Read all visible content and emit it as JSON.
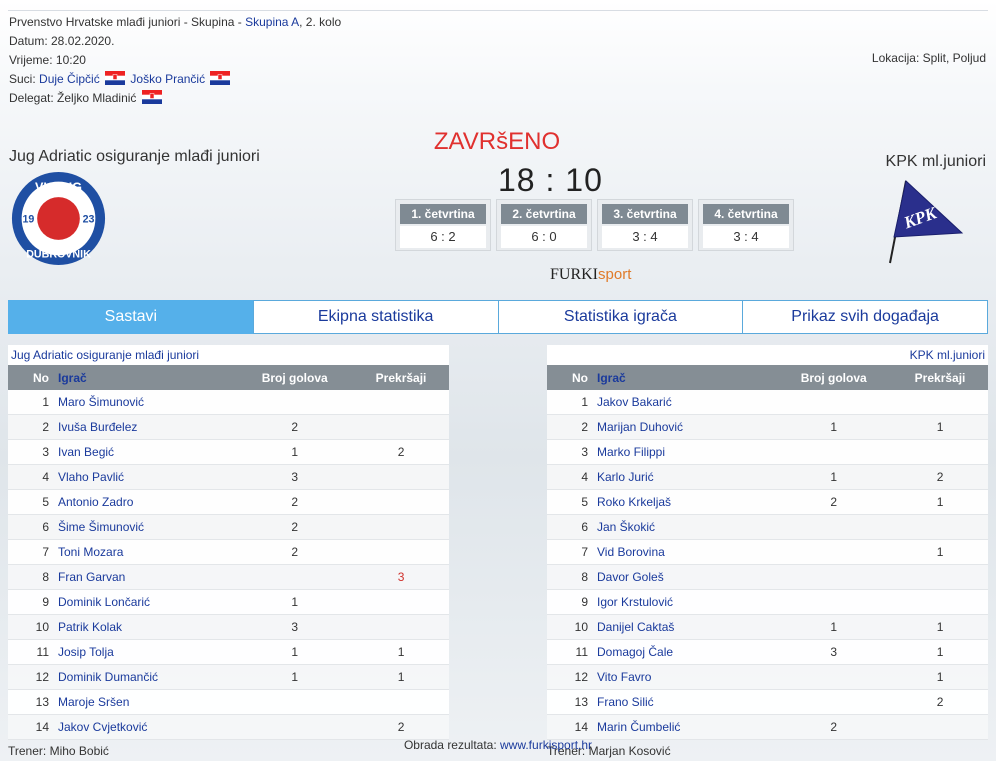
{
  "meta": {
    "competition_prefix": "Prvenstvo Hrvatske mlađi juniori - Skupina - ",
    "group_link": "Skupina A",
    "round": ", 2. kolo",
    "date": "Datum: 28.02.2020.",
    "time": "Vrijeme: 10:20",
    "referees_label": "Suci:",
    "referee_1": "Duje Čipčić",
    "referee_2": "Joško Prančić",
    "delegate_label": "Delegat:",
    "delegate": "Željko Mladinić",
    "location": "Lokacija: Split, Poljud"
  },
  "match": {
    "home_team": "Jug Adriatic osiguranje mlađi juniori",
    "away_team": "KPK ml.juniori",
    "status": "ZAVRšENO",
    "score": "18 : 10",
    "home_logo_text": {
      "top": "VK JUG",
      "bottom": "DUBROVNIK",
      "left": "19",
      "right": "23"
    },
    "away_logo_text": "KPK",
    "quarters": [
      {
        "label": "1. četvrtina",
        "score": "6 : 2"
      },
      {
        "label": "2. četvrtina",
        "score": "6 : 0"
      },
      {
        "label": "3. četvrtina",
        "score": "3 : 4"
      },
      {
        "label": "4. četvrtina",
        "score": "3 : 4"
      }
    ],
    "sponsor": {
      "a": "FURKI",
      "b": "sport"
    }
  },
  "tabs": [
    "Sastavi",
    "Ekipna statistika",
    "Statistika igrača",
    "Prikaz svih događaja"
  ],
  "columns": {
    "no": "No",
    "player": "Igrač",
    "goals": "Broj golova",
    "fouls": "Prekršaji"
  },
  "home": {
    "title": "Jug Adriatic osiguranje mlađi juniori",
    "coach": "Trener: Miho Bobić",
    "players": [
      {
        "no": "1",
        "name": "Maro Šimunović",
        "goals": "",
        "fouls": ""
      },
      {
        "no": "2",
        "name": "Ivuša Burđelez",
        "goals": "2",
        "fouls": ""
      },
      {
        "no": "3",
        "name": "Ivan Begić",
        "goals": "1",
        "fouls": "2"
      },
      {
        "no": "4",
        "name": "Vlaho Pavlić",
        "goals": "3",
        "fouls": ""
      },
      {
        "no": "5",
        "name": "Antonio Zadro",
        "goals": "2",
        "fouls": ""
      },
      {
        "no": "6",
        "name": "Šime Šimunović",
        "goals": "2",
        "fouls": ""
      },
      {
        "no": "7",
        "name": "Toni Mozara",
        "goals": "2",
        "fouls": ""
      },
      {
        "no": "8",
        "name": "Fran Garvan",
        "goals": "",
        "fouls": "3"
      },
      {
        "no": "9",
        "name": "Dominik Lončarić",
        "goals": "1",
        "fouls": ""
      },
      {
        "no": "10",
        "name": "Patrik Kolak",
        "goals": "3",
        "fouls": ""
      },
      {
        "no": "11",
        "name": "Josip Tolja",
        "goals": "1",
        "fouls": "1"
      },
      {
        "no": "12",
        "name": "Dominik Dumančić",
        "goals": "1",
        "fouls": "1"
      },
      {
        "no": "13",
        "name": "Maroje Sršen",
        "goals": "",
        "fouls": ""
      },
      {
        "no": "14",
        "name": "Jakov Cvjetković",
        "goals": "",
        "fouls": "2"
      }
    ]
  },
  "away": {
    "title": "KPK ml.juniori",
    "coach": "Trener: Marjan Kosović",
    "players": [
      {
        "no": "1",
        "name": "Jakov Bakarić",
        "goals": "",
        "fouls": ""
      },
      {
        "no": "2",
        "name": "Marijan Duhović",
        "goals": "1",
        "fouls": "1"
      },
      {
        "no": "3",
        "name": "Marko Filippi",
        "goals": "",
        "fouls": ""
      },
      {
        "no": "4",
        "name": "Karlo Jurić",
        "goals": "1",
        "fouls": "2"
      },
      {
        "no": "5",
        "name": "Roko Krkeljaš",
        "goals": "2",
        "fouls": "1"
      },
      {
        "no": "6",
        "name": "Jan Škokić",
        "goals": "",
        "fouls": ""
      },
      {
        "no": "7",
        "name": "Vid Borovina",
        "goals": "",
        "fouls": "1"
      },
      {
        "no": "8",
        "name": "Davor Goleš",
        "goals": "",
        "fouls": ""
      },
      {
        "no": "9",
        "name": "Igor Krstulović",
        "goals": "",
        "fouls": ""
      },
      {
        "no": "10",
        "name": "Danijel Caktaš",
        "goals": "1",
        "fouls": "1"
      },
      {
        "no": "11",
        "name": "Domagoj Čale",
        "goals": "3",
        "fouls": "1"
      },
      {
        "no": "12",
        "name": "Vito Favro",
        "goals": "",
        "fouls": "1"
      },
      {
        "no": "13",
        "name": "Frano Silić",
        "goals": "",
        "fouls": "2"
      },
      {
        "no": "14",
        "name": "Marin Čumbelić",
        "goals": "2",
        "fouls": ""
      }
    ]
  },
  "footer": {
    "label": "Obrada rezultata:",
    "link": "www.furkisport.hr"
  }
}
